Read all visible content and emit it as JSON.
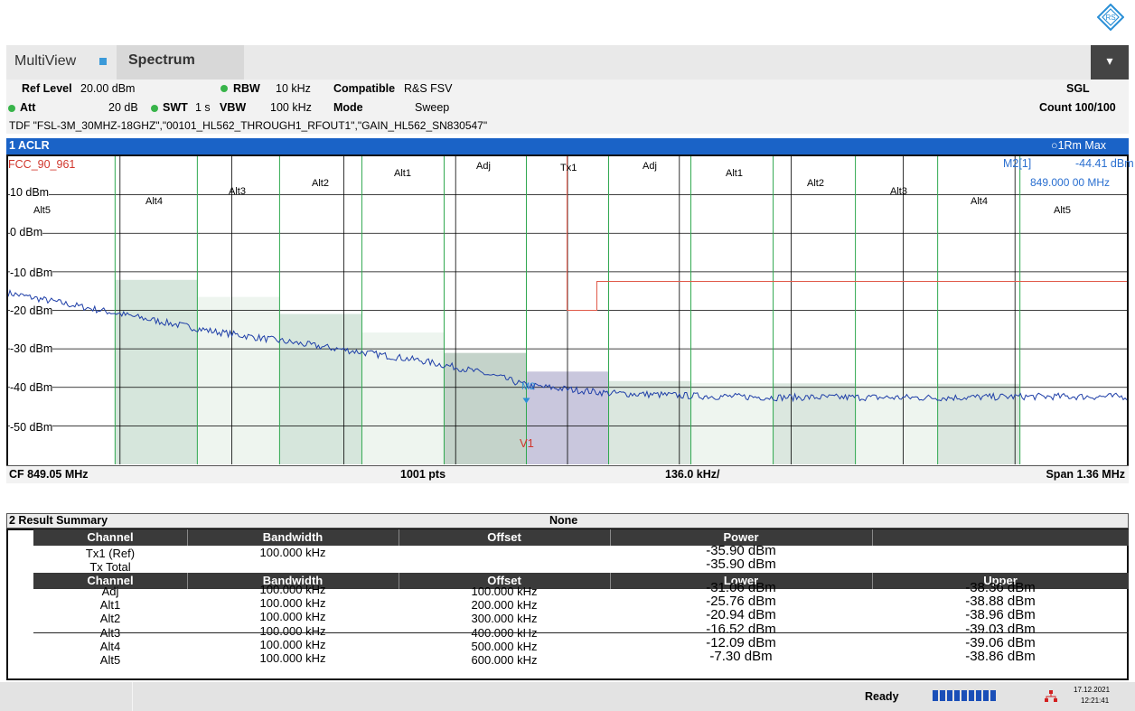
{
  "app": {
    "tabs": [
      "MultiView",
      "Spectrum"
    ],
    "menu_glyph": "▾"
  },
  "info": {
    "ref_level_label": "Ref Level",
    "ref_level_value": "20.00 dBm",
    "att_label": "Att",
    "att_value": "20 dB",
    "swt_label": "SWT",
    "swt_value": "1 s",
    "rbw_label": "RBW",
    "rbw_value": "10 kHz",
    "vbw_label": "VBW",
    "vbw_value": "100 kHz",
    "compatible_label": "Compatible",
    "compatible_value": "R&S FSV",
    "mode_label": "Mode",
    "mode_value": "Sweep",
    "sgl": "SGL",
    "count": "Count 100/100",
    "tdf": "TDF \"FSL-3M_30MHZ-18GHZ\",\"00101_HL562_THROUGH1_RFOUT1\",\"GAIN_HL562_SN830547\""
  },
  "plot": {
    "title": "1 ACLR",
    "trace_label": "1Rm Max",
    "limit_line_name": "FCC_90_961",
    "marker_label": "M2[1]",
    "marker_level": "-44.41 dBm",
    "marker_freq": "849.000 00 MHz",
    "marker_tag": "M2",
    "v_marker": "V1",
    "y_labels": [
      "10 dBm",
      "0 dBm",
      "-10 dBm",
      "-20 dBm",
      "-30 dBm",
      "-40 dBm",
      "-50 dBm"
    ],
    "channel_labels": {
      "alt5_l": "Alt5",
      "alt4_l": "Alt4",
      "alt3_l": "Alt3",
      "alt2_l": "Alt2",
      "alt1_l": "Alt1",
      "adj_l": "Adj",
      "tx1": "Tx1",
      "adj_r": "Adj",
      "alt1_r": "Alt1",
      "alt2_r": "Alt2",
      "alt3_r": "Alt3",
      "alt4_r": "Alt4",
      "alt5_r": "Alt5"
    },
    "footer": {
      "cf": "CF 849.05 MHz",
      "pts": "1001 pts",
      "div": "136.0 kHz/",
      "span": "Span 1.36 MHz"
    },
    "colors": {
      "trace": "#1f3fa8",
      "title_bg": "#1a63c7",
      "grid": "#000000",
      "channel_line": "#2fa84f",
      "limit": "#e05a4a"
    }
  },
  "chart_data": {
    "type": "line",
    "title": "1 ACLR",
    "x_range_mhz": [
      848.37,
      849.73
    ],
    "ylim": [
      -60,
      20
    ],
    "y_tick_labels": [
      "10 dBm",
      "0 dBm",
      "-10 dBm",
      "-20 dBm",
      "-30 dBm",
      "-40 dBm",
      "-50 dBm"
    ],
    "grid": true,
    "series": [
      {
        "name": "1Rm Max",
        "x": [
          848.37,
          848.42,
          848.47,
          848.52,
          848.57,
          848.62,
          848.67,
          848.72,
          848.77,
          848.82,
          848.87,
          848.92,
          848.97,
          849.0,
          849.05,
          849.1,
          849.2,
          849.3,
          849.4,
          849.5,
          849.6,
          849.73
        ],
        "values": [
          -15.5,
          -17.5,
          -19.5,
          -21.5,
          -23.5,
          -25.5,
          -27,
          -28.5,
          -30,
          -31.5,
          -33,
          -35,
          -37.5,
          -39.5,
          -40.5,
          -41.5,
          -42.2,
          -42.6,
          -42.6,
          -42.7,
          -42.4,
          -42.4
        ]
      }
    ],
    "channel_bars": [
      {
        "name": "Alt4",
        "side": "lower",
        "value": -12.09
      },
      {
        "name": "Alt2",
        "side": "lower",
        "value": -20.94
      },
      {
        "name": "Adj",
        "side": "lower",
        "value": -31.06
      },
      {
        "name": "Tx1",
        "side": "center",
        "value": -35.9
      },
      {
        "name": "Adj",
        "side": "upper",
        "value": -38.36
      },
      {
        "name": "Alt2",
        "side": "upper",
        "value": -38.96
      },
      {
        "name": "Alt4",
        "side": "upper",
        "value": -39.06
      }
    ]
  },
  "result_summary": {
    "title": "2 Result Summary",
    "mode": "None",
    "header1": [
      "Channel",
      "Bandwidth",
      "Offset",
      "Power",
      ""
    ],
    "tx_rows": [
      {
        "channel": "Tx1 (Ref)",
        "bandwidth": "100.000 kHz",
        "offset": "",
        "power": "-35.90 dBm"
      },
      {
        "channel": "Tx Total",
        "bandwidth": "",
        "offset": "",
        "power": "-35.90 dBm"
      }
    ],
    "header2": [
      "Channel",
      "Bandwidth",
      "Offset",
      "Lower",
      "Upper"
    ],
    "rows": [
      {
        "channel": "Adj",
        "bandwidth": "100.000 kHz",
        "offset": "100.000 kHz",
        "lower": "-31.06 dBm",
        "upper": "-38.36 dBm"
      },
      {
        "channel": "Alt1",
        "bandwidth": "100.000 kHz",
        "offset": "200.000 kHz",
        "lower": "-25.76 dBm",
        "upper": "-38.88 dBm"
      },
      {
        "channel": "Alt2",
        "bandwidth": "100.000 kHz",
        "offset": "300.000 kHz",
        "lower": "-20.94 dBm",
        "upper": "-38.96 dBm"
      },
      {
        "channel": "Alt3",
        "bandwidth": "100.000 kHz",
        "offset": "400.000 kHz",
        "lower": "-16.52 dBm",
        "upper": "-39.03 dBm"
      },
      {
        "channel": "Alt4",
        "bandwidth": "100.000 kHz",
        "offset": "500.000 kHz",
        "lower": "-12.09 dBm",
        "upper": "-39.06 dBm"
      },
      {
        "channel": "Alt5",
        "bandwidth": "100.000 kHz",
        "offset": "600.000 kHz",
        "lower": "-7.30 dBm",
        "upper": "-38.86 dBm"
      }
    ]
  },
  "status": {
    "ready": "Ready",
    "date": "17.12.2021",
    "time": "12:21:41",
    "progress": 1.0
  }
}
